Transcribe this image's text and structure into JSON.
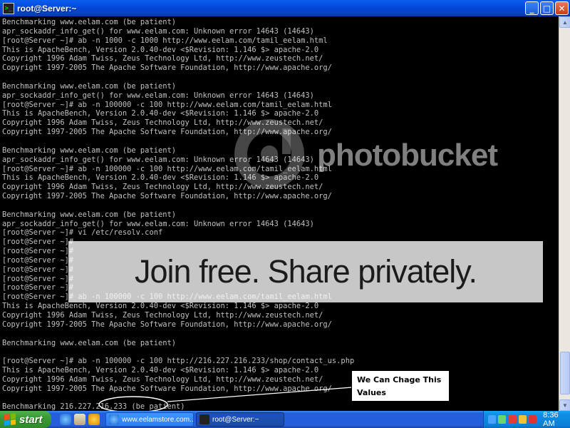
{
  "window": {
    "title": "root@Server:~",
    "buttons": {
      "minimize": "_",
      "maximize": "□",
      "close": "✕"
    }
  },
  "terminal": {
    "lines": [
      "Benchmarking www.eelam.com (be patient)",
      "apr_sockaddr_info_get() for www.eelam.com: Unknown error 14643 (14643)",
      "[root@Server ~]# ab -n 1000 -c 1000 http://www.eelam.com/tamil_eelam.html",
      "This is ApacheBench, Version 2.0.40-dev <$Revision: 1.146 $> apache-2.0",
      "Copyright 1996 Adam Twiss, Zeus Technology Ltd, http://www.zeustech.net/",
      "Copyright 1997-2005 The Apache Software Foundation, http://www.apache.org/",
      "",
      "Benchmarking www.eelam.com (be patient)",
      "apr_sockaddr_info_get() for www.eelam.com: Unknown error 14643 (14643)",
      "[root@Server ~]# ab -n 100000 -c 100 http://www.eelam.com/tamil_eelam.html",
      "This is ApacheBench, Version 2.0.40-dev <$Revision: 1.146 $> apache-2.0",
      "Copyright 1996 Adam Twiss, Zeus Technology Ltd, http://www.zeustech.net/",
      "Copyright 1997-2005 The Apache Software Foundation, http://www.apache.org/",
      "",
      "Benchmarking www.eelam.com (be patient)",
      "apr_sockaddr_info_get() for www.eelam.com: Unknown error 14643 (14643)",
      "[root@Server ~]# ab -n 100000 -c 100 http://www.eelam.com/tamil_eelam.html",
      "This is ApacheBench, Version 2.0.40-dev <$Revision: 1.146 $> apache-2.0",
      "Copyright 1996 Adam Twiss, Zeus Technology Ltd, http://www.zeustech.net/",
      "Copyright 1997-2005 The Apache Software Foundation, http://www.apache.org/",
      "",
      "Benchmarking www.eelam.com (be patient)",
      "apr_sockaddr_info_get() for www.eelam.com: Unknown error 14643 (14643)",
      "[root@Server ~]# vi /etc/resolv.conf",
      "[root@Server ~]#",
      "[root@Server ~]#",
      "[root@Server ~]#",
      "[root@Server ~]#",
      "[root@Server ~]#",
      "[root@Server ~]#",
      "[root@Server ~]# ab -n 100000 -c 100 http://www.eelam.com/tamil_eelam.html",
      "This is ApacheBench, Version 2.0.40-dev <$Revision: 1.146 $> apache-2.0",
      "Copyright 1996 Adam Twiss, Zeus Technology Ltd, http://www.zeustech.net/",
      "Copyright 1997-2005 The Apache Software Foundation, http://www.apache.org/",
      "",
      "Benchmarking www.eelam.com (be patient)",
      "",
      "[root@Server ~]# ab -n 100000 -c 100 http://216.227.216.233/shop/contact_us.php",
      "This is ApacheBench, Version 2.0.40-dev <$Revision: 1.146 $> apache-2.0",
      "Copyright 1996 Adam Twiss, Zeus Technology Ltd, http://www.zeustech.net/",
      "Copyright 1997-2005 The Apache Software Foundation, http://www.apache.org/",
      "",
      "Benchmarking 216.227.216.233 (be patient)",
      ""
    ],
    "prompt_line": "[root@Server ~]# ab -n 100000 -c 100 http://216.227.216.233/shop/contact_us.php",
    "cursor_color": "#00cc00",
    "text_color": "#c0c0c0",
    "background": "#000000"
  },
  "annotation": {
    "text": "We Can Chage This Values"
  },
  "watermark": {
    "banner": "Join free. Share privately.",
    "logo": "photobucket"
  },
  "taskbar": {
    "start_label": "start",
    "tasks": [
      {
        "label": "www.eelamstore.com...",
        "icon": "internet-explorer-icon",
        "active": false
      },
      {
        "label": "root@Server:~",
        "icon": "terminal-icon",
        "active": true
      }
    ],
    "clock": "8:36 AM"
  }
}
